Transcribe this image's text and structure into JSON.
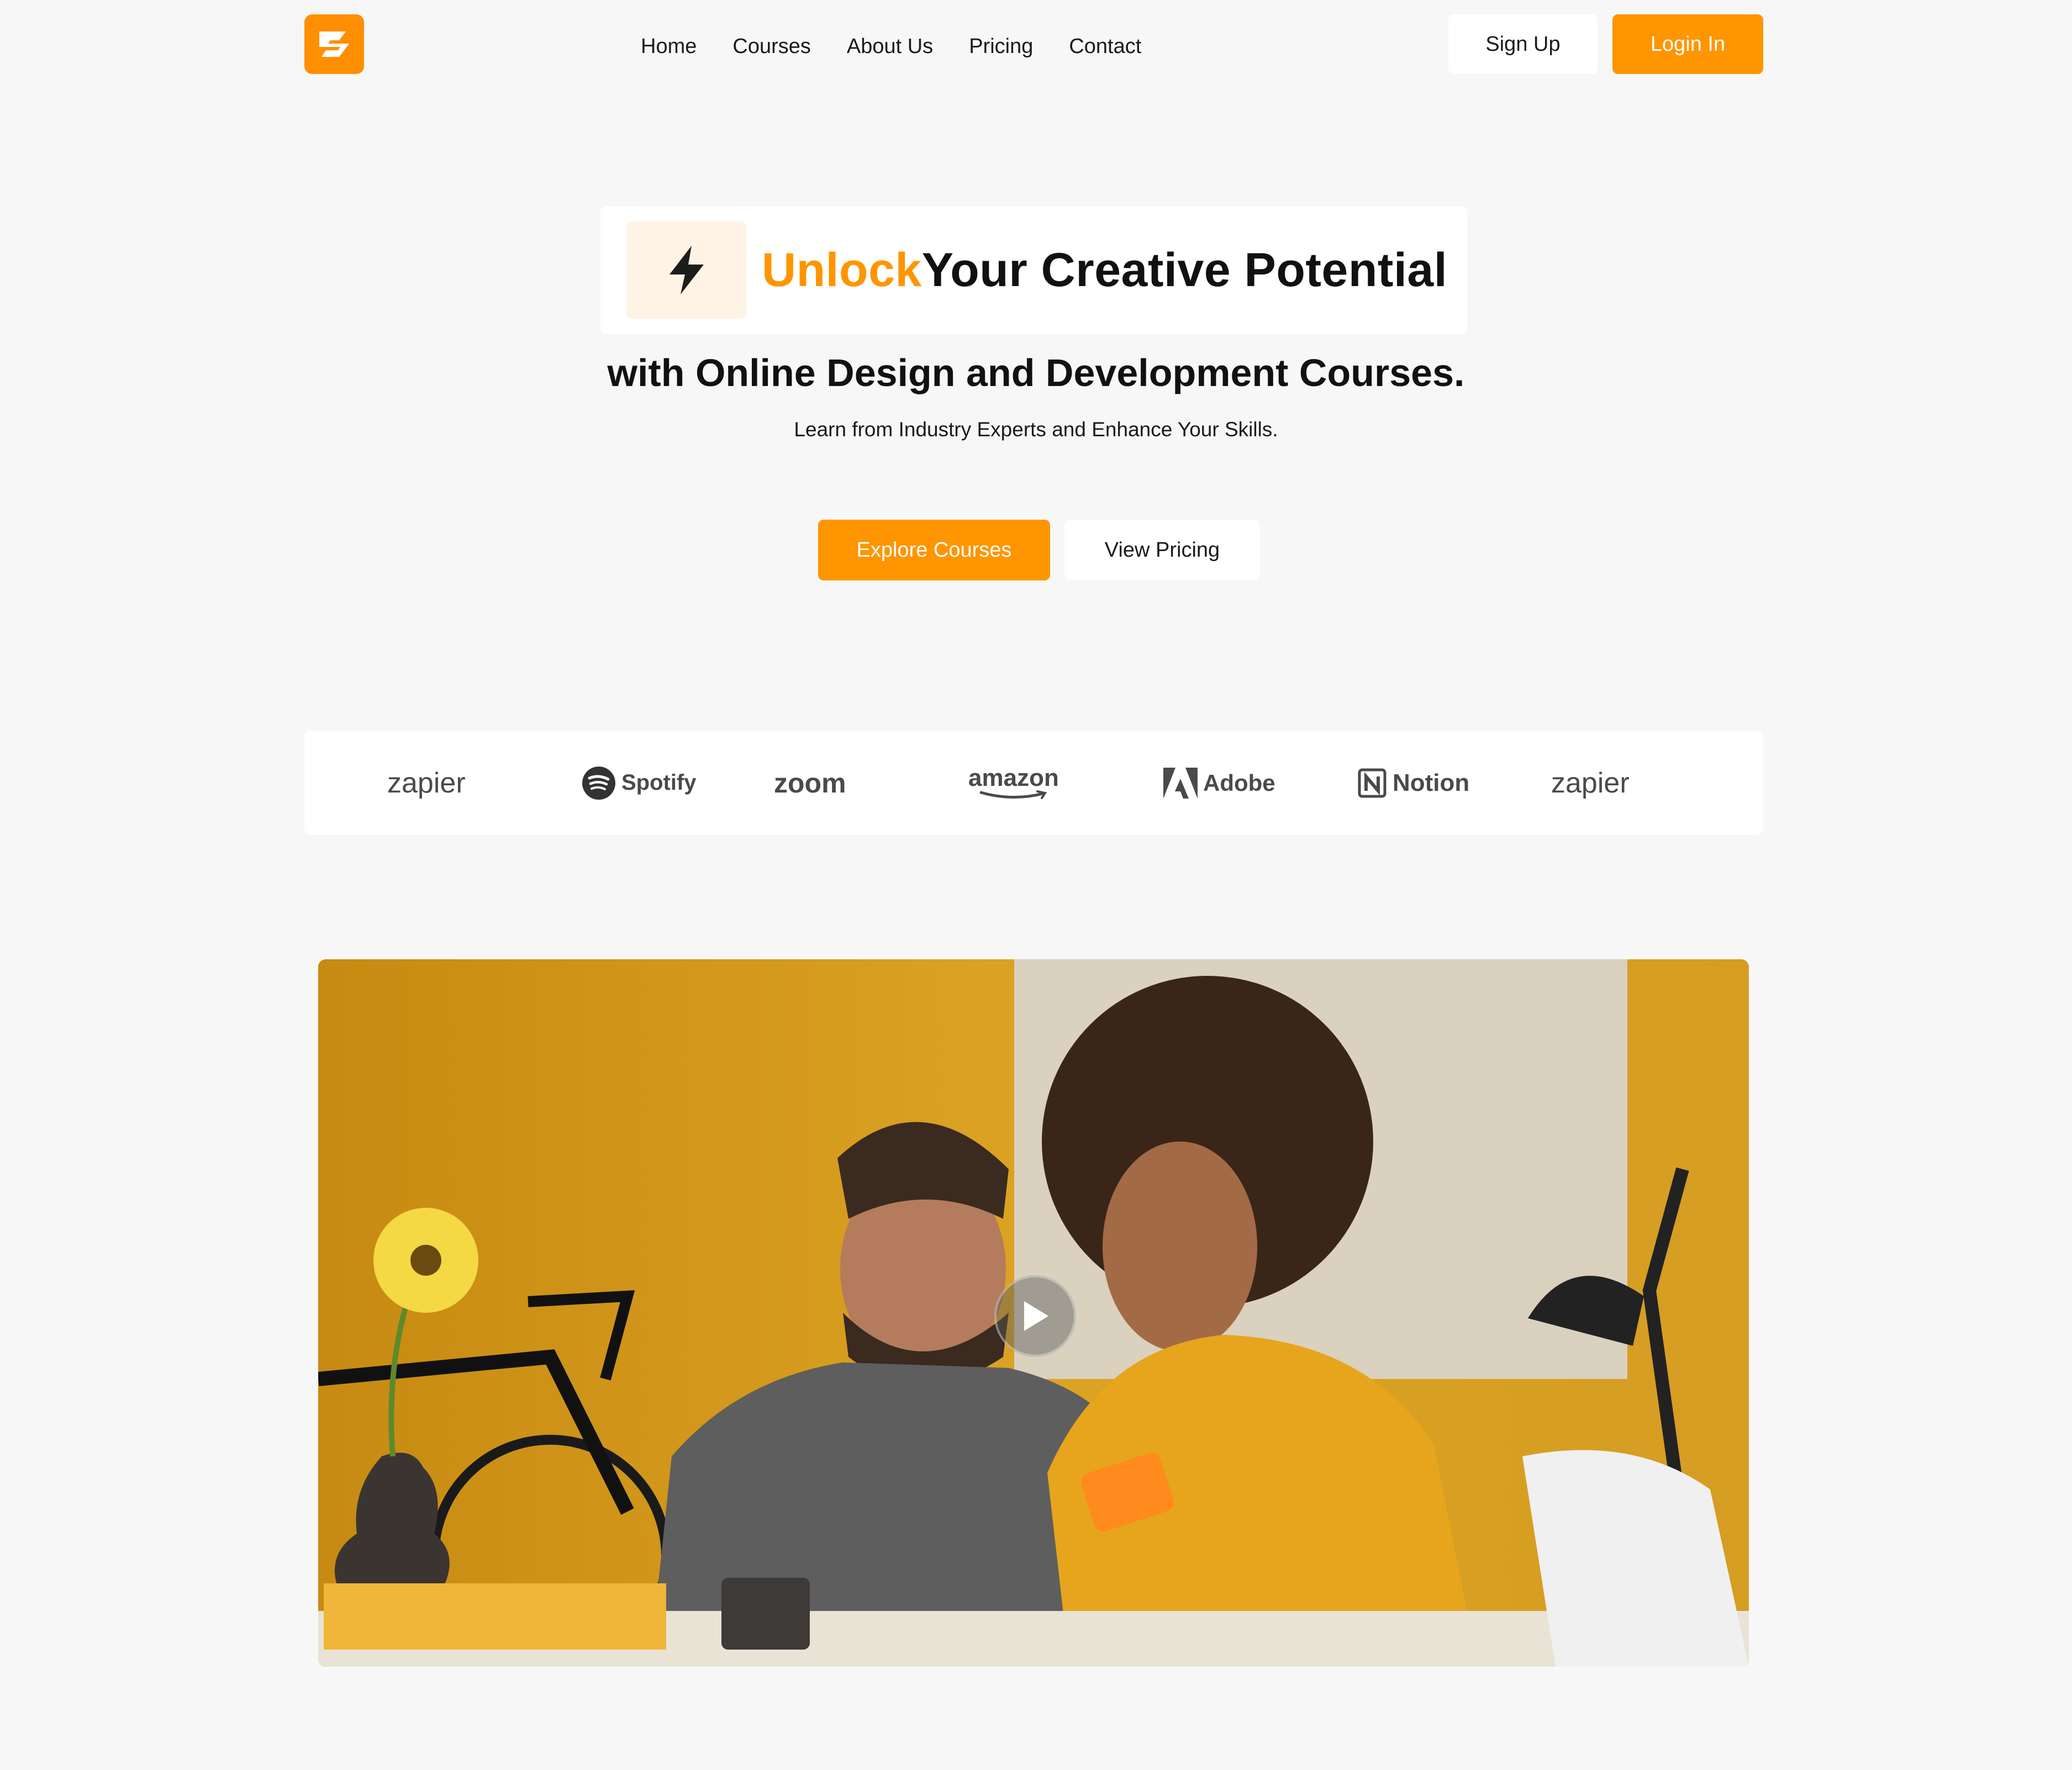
{
  "colors": {
    "accent": "#ff9500",
    "background": "#f7f7f7",
    "card": "#ffffff",
    "text": "#111111",
    "bolt_box": "#fff3e6"
  },
  "header": {
    "logo_icon": "logo-icon",
    "nav": [
      "Home",
      "Courses",
      "About Us",
      "Pricing",
      "Contact"
    ],
    "sign_up": "Sign Up",
    "login": "Login In"
  },
  "hero": {
    "icon": "lightning-icon",
    "headline_accent": "Unlock",
    "headline_rest": "Your Creative Potential",
    "subheadline": "with Online Design and Development Courses.",
    "tagline": "Learn from Industry Experts and Enhance Your Skills.",
    "primary_cta": "Explore Courses",
    "secondary_cta": "View Pricing"
  },
  "partners": {
    "logos": [
      {
        "name": "zapier",
        "icon": "zapier-logo"
      },
      {
        "name": "Spotify",
        "icon": "spotify-logo"
      },
      {
        "name": "zoom",
        "icon": "zoom-logo"
      },
      {
        "name": "amazon",
        "icon": "amazon-logo"
      },
      {
        "name": "Adobe",
        "icon": "adobe-logo"
      },
      {
        "name": "Notion",
        "icon": "notion-logo"
      },
      {
        "name": "zapier",
        "icon": "zapier-logo"
      }
    ]
  },
  "video": {
    "play_icon": "play-icon"
  }
}
